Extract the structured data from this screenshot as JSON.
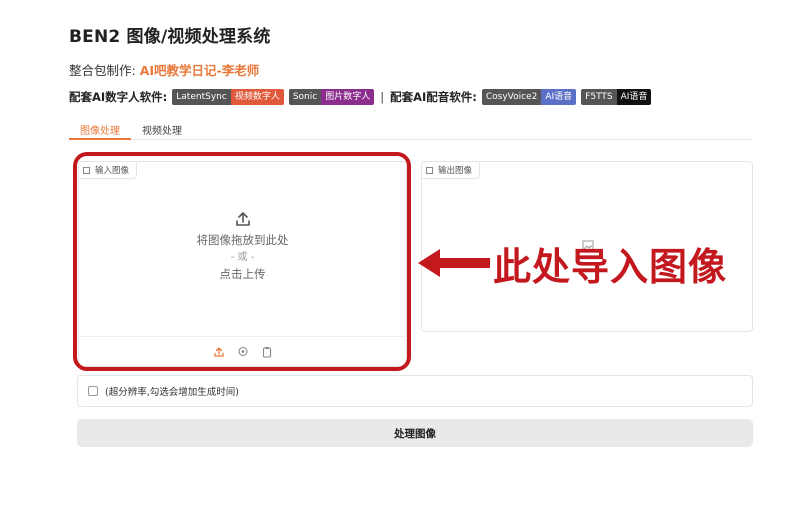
{
  "header": {
    "title": "BEN2 图像/视频处理系统",
    "maker_label": "整合包制作:",
    "maker_name": "AI吧教学日记-李老师"
  },
  "software": {
    "digital_human_label": "配套AI数字人软件:",
    "digital_human": [
      {
        "name": "LatentSync",
        "tag": "视频数字人",
        "color": "#e0593a"
      },
      {
        "name": "Sonic",
        "tag": "图片数字人",
        "color": "#8a2d8c"
      }
    ],
    "separator": "|",
    "voice_label": "配套AI配音软件:",
    "voice": [
      {
        "name": "CosyVoice2",
        "tag": "AI语音",
        "color": "#5b6fc7"
      },
      {
        "name": "F5TTS",
        "tag": "AI语音",
        "color": "#111111"
      }
    ]
  },
  "tabs": [
    {
      "label": "图像处理",
      "active": true
    },
    {
      "label": "视频处理",
      "active": false
    }
  ],
  "input_panel": {
    "label": "输入图像",
    "drop_text": "将图像拖放到此处",
    "or_text": "- 或 -",
    "click_text": "点击上传"
  },
  "output_panel": {
    "label": "输出图像"
  },
  "annotation": {
    "text": "此处导入图像",
    "color": "#c4181f"
  },
  "options": {
    "superres_label": "(超分辨率,勾选会增加生成时间)",
    "superres_checked": false
  },
  "actions": {
    "process_label": "处理图像"
  },
  "colors": {
    "accent": "#e8793a",
    "annotation_red": "#c4181f"
  }
}
